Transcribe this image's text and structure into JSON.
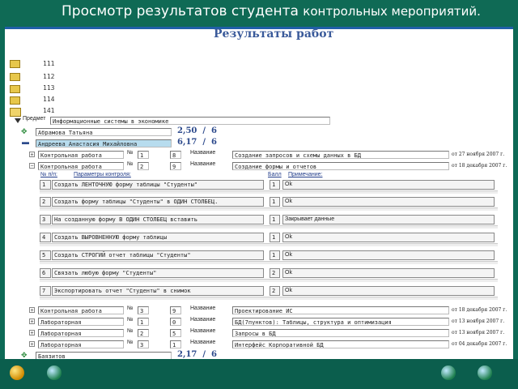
{
  "slide": {
    "title_main": "Просмотр результатов студента",
    "title_small": "контрольных мероприятий."
  },
  "page": {
    "title": "Результаты работ"
  },
  "groups": [
    "111",
    "112",
    "113",
    "114",
    "141"
  ],
  "subject": {
    "label": "Предмет",
    "value": "Информационные системы в экономике"
  },
  "students": [
    {
      "name": "Абрамова Татьяна",
      "score": "2,50",
      "sep": "/",
      "max": "6"
    },
    {
      "name": "Андреева Анастасия Михайловна",
      "score": "6,17",
      "sep": "/",
      "max": "6"
    }
  ],
  "works": [
    {
      "type": "Контрольная работа",
      "no_label": "№",
      "no": "1",
      "grade": "8",
      "name_label": "Название",
      "name": "Создание запросов и схемы данных в БД",
      "date": "от 27 ноября 2007 г."
    },
    {
      "type": "Контрольная работа",
      "no_label": "№",
      "no": "2",
      "grade": "9",
      "name_label": "Название",
      "name": "Создание формы и отчетов",
      "date": "от 18 декабря 2007 г."
    }
  ],
  "task_columns": {
    "no": "№ п/п:",
    "params": "Параметры контроля:",
    "score": "Балл",
    "note": "Примечание:"
  },
  "tasks": [
    {
      "no": "1",
      "text": "Создать ЛЕНТОЧНУЮ форму таблицы \"Студенты\"",
      "score": "1",
      "note": "Ok"
    },
    {
      "no": "2",
      "text": "Создать форму таблицы \"Студенты\" в ОДИН СТОЛБЕЦ.",
      "score": "1",
      "note": "Ok"
    },
    {
      "no": "3",
      "text": "На созданную форму В ОДИН СТОЛБЕЦ вставить",
      "score": "1",
      "note": "Закрывает данные"
    },
    {
      "no": "4",
      "text": "Создать ВЫРОВНЕННУЮ форму таблицы",
      "score": "1",
      "note": "Ok"
    },
    {
      "no": "5",
      "text": "Создать СТРОГИЙ отчет таблицы \"Студенты\"",
      "score": "1",
      "note": "Ok"
    },
    {
      "no": "6",
      "text": "Связать любую форму \"Студенты\"",
      "score": "2",
      "note": "Ok"
    },
    {
      "no": "7",
      "text": "Экспортировать отчет \"Студенты\" в снимок",
      "score": "2",
      "note": "Ok"
    }
  ],
  "works2": [
    {
      "type": "Контрольная работа",
      "no_label": "№",
      "no": "3",
      "grade": "9",
      "name_label": "Название",
      "name": "Проектирование ИС",
      "date": "от 18 декабря 2007 г."
    },
    {
      "type": "Лабораторная",
      "no_label": "№",
      "no": "1",
      "grade": "0",
      "name_label": "Название",
      "name": "БД(7пунктов): Таблицы, структура и оптимизация",
      "date": "от 13 ноября 2007 г."
    },
    {
      "type": "Лабораторная",
      "no_label": "№",
      "no": "2",
      "grade": "5",
      "name_label": "Название",
      "name": "Запросы в БД",
      "date": "от 13 ноября 2007 г."
    },
    {
      "type": "Лабораторная",
      "no_label": "№",
      "no": "3",
      "grade": "1",
      "name_label": "Название",
      "name": "Интерфейс Корпоративной БД",
      "date": "от 04 декабря 2007 г."
    }
  ],
  "last_student": {
    "name": "Баязитов",
    "score": "2,17",
    "sep": "/",
    "max": "6"
  },
  "colors": {
    "accent": "#0d6a56",
    "highlight": "#b7dcee",
    "score": "#2d4a8c"
  }
}
